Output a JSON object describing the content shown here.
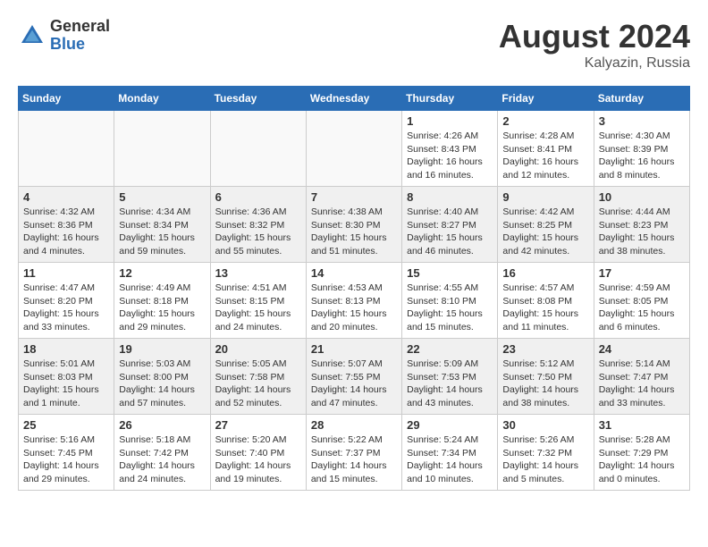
{
  "header": {
    "logo_general": "General",
    "logo_blue": "Blue",
    "month_year": "August 2024",
    "location": "Kalyazin, Russia"
  },
  "days_of_week": [
    "Sunday",
    "Monday",
    "Tuesday",
    "Wednesday",
    "Thursday",
    "Friday",
    "Saturday"
  ],
  "weeks": [
    [
      {
        "day": "",
        "info": "",
        "empty": true
      },
      {
        "day": "",
        "info": "",
        "empty": true
      },
      {
        "day": "",
        "info": "",
        "empty": true
      },
      {
        "day": "",
        "info": "",
        "empty": true
      },
      {
        "day": "1",
        "info": "Sunrise: 4:26 AM\nSunset: 8:43 PM\nDaylight: 16 hours\nand 16 minutes.",
        "empty": false
      },
      {
        "day": "2",
        "info": "Sunrise: 4:28 AM\nSunset: 8:41 PM\nDaylight: 16 hours\nand 12 minutes.",
        "empty": false
      },
      {
        "day": "3",
        "info": "Sunrise: 4:30 AM\nSunset: 8:39 PM\nDaylight: 16 hours\nand 8 minutes.",
        "empty": false
      }
    ],
    [
      {
        "day": "4",
        "info": "Sunrise: 4:32 AM\nSunset: 8:36 PM\nDaylight: 16 hours\nand 4 minutes.",
        "empty": false
      },
      {
        "day": "5",
        "info": "Sunrise: 4:34 AM\nSunset: 8:34 PM\nDaylight: 15 hours\nand 59 minutes.",
        "empty": false
      },
      {
        "day": "6",
        "info": "Sunrise: 4:36 AM\nSunset: 8:32 PM\nDaylight: 15 hours\nand 55 minutes.",
        "empty": false
      },
      {
        "day": "7",
        "info": "Sunrise: 4:38 AM\nSunset: 8:30 PM\nDaylight: 15 hours\nand 51 minutes.",
        "empty": false
      },
      {
        "day": "8",
        "info": "Sunrise: 4:40 AM\nSunset: 8:27 PM\nDaylight: 15 hours\nand 46 minutes.",
        "empty": false
      },
      {
        "day": "9",
        "info": "Sunrise: 4:42 AM\nSunset: 8:25 PM\nDaylight: 15 hours\nand 42 minutes.",
        "empty": false
      },
      {
        "day": "10",
        "info": "Sunrise: 4:44 AM\nSunset: 8:23 PM\nDaylight: 15 hours\nand 38 minutes.",
        "empty": false
      }
    ],
    [
      {
        "day": "11",
        "info": "Sunrise: 4:47 AM\nSunset: 8:20 PM\nDaylight: 15 hours\nand 33 minutes.",
        "empty": false
      },
      {
        "day": "12",
        "info": "Sunrise: 4:49 AM\nSunset: 8:18 PM\nDaylight: 15 hours\nand 29 minutes.",
        "empty": false
      },
      {
        "day": "13",
        "info": "Sunrise: 4:51 AM\nSunset: 8:15 PM\nDaylight: 15 hours\nand 24 minutes.",
        "empty": false
      },
      {
        "day": "14",
        "info": "Sunrise: 4:53 AM\nSunset: 8:13 PM\nDaylight: 15 hours\nand 20 minutes.",
        "empty": false
      },
      {
        "day": "15",
        "info": "Sunrise: 4:55 AM\nSunset: 8:10 PM\nDaylight: 15 hours\nand 15 minutes.",
        "empty": false
      },
      {
        "day": "16",
        "info": "Sunrise: 4:57 AM\nSunset: 8:08 PM\nDaylight: 15 hours\nand 11 minutes.",
        "empty": false
      },
      {
        "day": "17",
        "info": "Sunrise: 4:59 AM\nSunset: 8:05 PM\nDaylight: 15 hours\nand 6 minutes.",
        "empty": false
      }
    ],
    [
      {
        "day": "18",
        "info": "Sunrise: 5:01 AM\nSunset: 8:03 PM\nDaylight: 15 hours\nand 1 minute.",
        "empty": false
      },
      {
        "day": "19",
        "info": "Sunrise: 5:03 AM\nSunset: 8:00 PM\nDaylight: 14 hours\nand 57 minutes.",
        "empty": false
      },
      {
        "day": "20",
        "info": "Sunrise: 5:05 AM\nSunset: 7:58 PM\nDaylight: 14 hours\nand 52 minutes.",
        "empty": false
      },
      {
        "day": "21",
        "info": "Sunrise: 5:07 AM\nSunset: 7:55 PM\nDaylight: 14 hours\nand 47 minutes.",
        "empty": false
      },
      {
        "day": "22",
        "info": "Sunrise: 5:09 AM\nSunset: 7:53 PM\nDaylight: 14 hours\nand 43 minutes.",
        "empty": false
      },
      {
        "day": "23",
        "info": "Sunrise: 5:12 AM\nSunset: 7:50 PM\nDaylight: 14 hours\nand 38 minutes.",
        "empty": false
      },
      {
        "day": "24",
        "info": "Sunrise: 5:14 AM\nSunset: 7:47 PM\nDaylight: 14 hours\nand 33 minutes.",
        "empty": false
      }
    ],
    [
      {
        "day": "25",
        "info": "Sunrise: 5:16 AM\nSunset: 7:45 PM\nDaylight: 14 hours\nand 29 minutes.",
        "empty": false
      },
      {
        "day": "26",
        "info": "Sunrise: 5:18 AM\nSunset: 7:42 PM\nDaylight: 14 hours\nand 24 minutes.",
        "empty": false
      },
      {
        "day": "27",
        "info": "Sunrise: 5:20 AM\nSunset: 7:40 PM\nDaylight: 14 hours\nand 19 minutes.",
        "empty": false
      },
      {
        "day": "28",
        "info": "Sunrise: 5:22 AM\nSunset: 7:37 PM\nDaylight: 14 hours\nand 15 minutes.",
        "empty": false
      },
      {
        "day": "29",
        "info": "Sunrise: 5:24 AM\nSunset: 7:34 PM\nDaylight: 14 hours\nand 10 minutes.",
        "empty": false
      },
      {
        "day": "30",
        "info": "Sunrise: 5:26 AM\nSunset: 7:32 PM\nDaylight: 14 hours\nand 5 minutes.",
        "empty": false
      },
      {
        "day": "31",
        "info": "Sunrise: 5:28 AM\nSunset: 7:29 PM\nDaylight: 14 hours\nand 0 minutes.",
        "empty": false
      }
    ]
  ]
}
